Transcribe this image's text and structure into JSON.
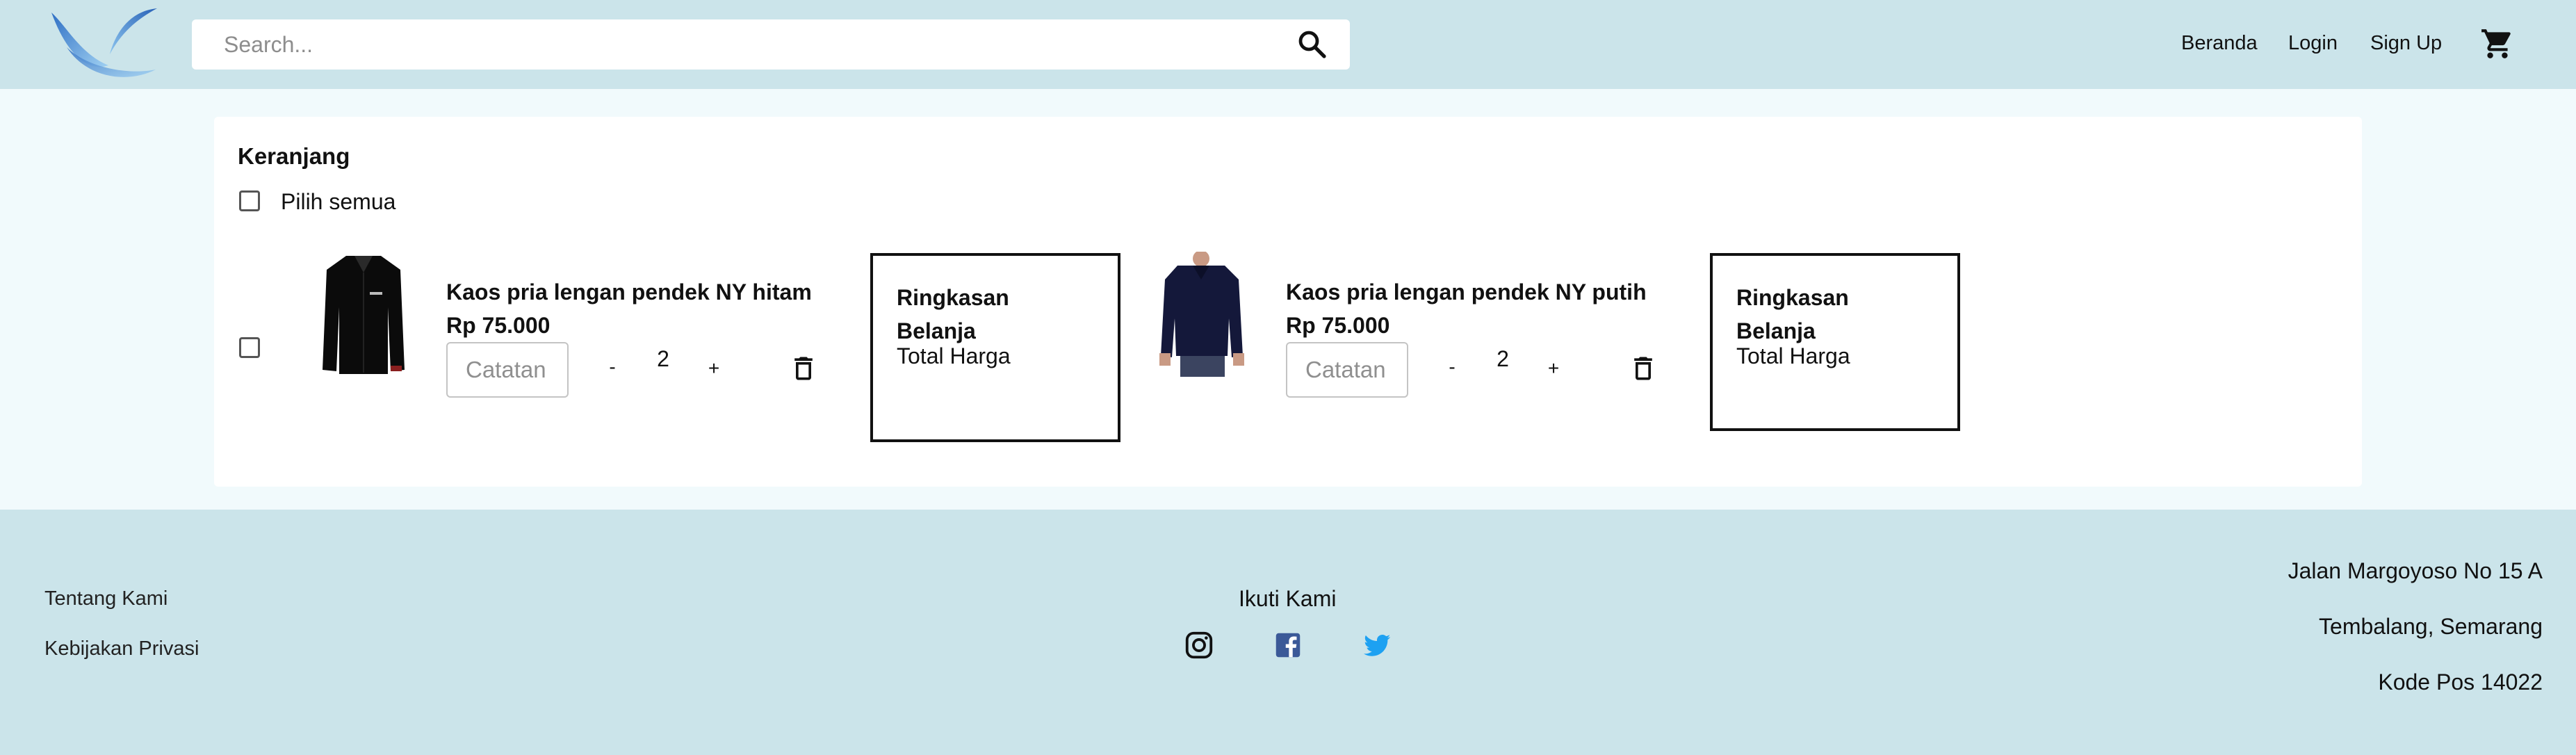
{
  "header": {
    "search_placeholder": "Search...",
    "nav": {
      "home": "Beranda",
      "login": "Login",
      "signup": "Sign Up"
    },
    "icons": {
      "logo": "bird-logo",
      "search": "search-icon",
      "cart": "cart-icon"
    }
  },
  "cart": {
    "title": "Keranjang",
    "select_all_label": "Pilih semua",
    "items": [
      {
        "name": "Kaos pria lengan pendek NY hitam",
        "price": "Rp 75.000",
        "note_placeholder": "Catatan",
        "minus": "-",
        "quantity": "2",
        "plus": "+",
        "image": "black-shirt-photo",
        "summary": {
          "title": "Ringkasan Belanja",
          "total_label": "Total Harga"
        }
      },
      {
        "name": "Kaos pria lengan pendek NY putih",
        "price": "Rp 75.000",
        "note_placeholder": "Catatan",
        "minus": "-",
        "quantity": "2",
        "plus": "+",
        "image": "navy-sweater-photo",
        "summary": {
          "title": "Ringkasan Belanja",
          "total_label": "Total Harga"
        }
      }
    ]
  },
  "footer": {
    "links": {
      "about": "Tentang Kami",
      "privacy": "Kebijakan Privasi"
    },
    "follow_title": "Ikuti Kami",
    "social": [
      "instagram-icon",
      "facebook-icon",
      "twitter-icon"
    ],
    "address": [
      "Jalan Margoyoso No 15 A",
      "Tembalang, Semarang",
      "Kode Pos 14022"
    ]
  },
  "colors": {
    "header_bg": "#cbe4ea",
    "page_bg": "#f1fafc",
    "facebook": "#3b5998",
    "twitter": "#1da1f2",
    "logo_blue": "#3f86d6"
  }
}
